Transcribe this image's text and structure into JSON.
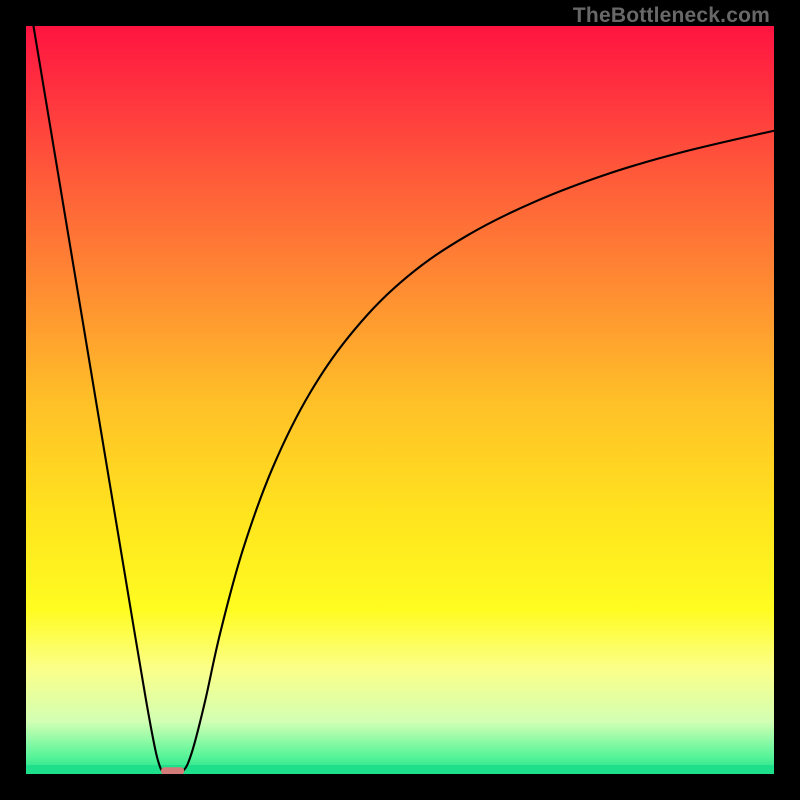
{
  "watermark": "TheBottleneck.com",
  "chart_data": {
    "type": "line",
    "title": "",
    "xlabel": "",
    "ylabel": "",
    "xlim": [
      0,
      100
    ],
    "ylim": [
      0,
      100
    ],
    "grid": false,
    "legend": false,
    "background_gradient": {
      "stops": [
        {
          "offset": 0.0,
          "color": "#ff1440"
        },
        {
          "offset": 0.08,
          "color": "#ff2f3f"
        },
        {
          "offset": 0.2,
          "color": "#ff5a3a"
        },
        {
          "offset": 0.35,
          "color": "#ff8c32"
        },
        {
          "offset": 0.5,
          "color": "#ffbf28"
        },
        {
          "offset": 0.65,
          "color": "#ffe31e"
        },
        {
          "offset": 0.78,
          "color": "#fffc20"
        },
        {
          "offset": 0.86,
          "color": "#fbff8a"
        },
        {
          "offset": 0.93,
          "color": "#d2ffb3"
        },
        {
          "offset": 0.975,
          "color": "#5bf59a"
        },
        {
          "offset": 1.0,
          "color": "#1ee08a"
        }
      ]
    },
    "series": [
      {
        "name": "left-branch",
        "x": [
          1,
          3,
          6,
          9,
          12,
          14.5,
          16.2,
          17.3,
          17.9,
          18.2
        ],
        "y": [
          100,
          88,
          70,
          52,
          34,
          19,
          9,
          3.2,
          1.0,
          0.4
        ]
      },
      {
        "name": "right-branch",
        "x": [
          21.0,
          21.6,
          22.5,
          24,
          26,
          29,
          33,
          38,
          44,
          51,
          59,
          68,
          78,
          88,
          100
        ],
        "y": [
          0.4,
          1.3,
          4,
          10,
          19,
          30,
          41,
          51,
          59.5,
          66.5,
          72,
          76.5,
          80.3,
          83.2,
          86
        ]
      }
    ],
    "marker": {
      "name": "optimal-marker",
      "x_center": 19.6,
      "y": 0.4,
      "width": 3.1,
      "height": 1.0,
      "color": "#d37b79"
    }
  }
}
